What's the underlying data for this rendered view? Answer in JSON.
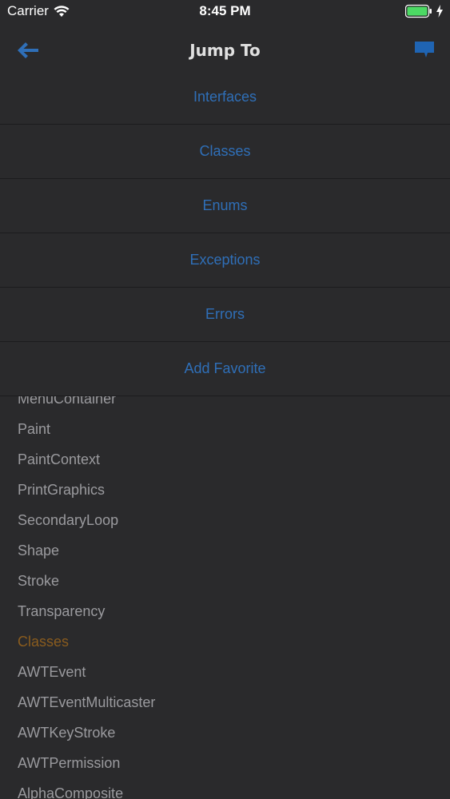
{
  "status_bar": {
    "carrier": "Carrier",
    "time": "8:45 PM"
  },
  "nav": {
    "title": "Jump To",
    "back_icon": "arrow-left-icon",
    "comment_icon": "comment-icon"
  },
  "jump_menu": {
    "items": [
      {
        "label": "Interfaces"
      },
      {
        "label": "Classes"
      },
      {
        "label": "Enums"
      },
      {
        "label": "Exceptions"
      },
      {
        "label": "Errors"
      },
      {
        "label": "Add Favorite"
      }
    ]
  },
  "list": {
    "items": [
      {
        "label": "MenuContainer"
      },
      {
        "label": "Paint"
      },
      {
        "label": "PaintContext"
      },
      {
        "label": "PrintGraphics"
      },
      {
        "label": "SecondaryLoop"
      },
      {
        "label": "Shape"
      },
      {
        "label": "Stroke"
      },
      {
        "label": "Transparency"
      },
      {
        "label": "Classes"
      },
      {
        "label": "AWTEvent"
      },
      {
        "label": "AWTEventMulticaster"
      },
      {
        "label": "AWTKeyStroke"
      },
      {
        "label": "AWTPermission"
      },
      {
        "label": "AlphaComposite"
      }
    ]
  },
  "colors": {
    "background": "#2a2a2c",
    "link": "#2f6fb8",
    "list_text": "#9a9a9e",
    "section_header": "#8a5c1e",
    "battery": "#4cd964"
  }
}
